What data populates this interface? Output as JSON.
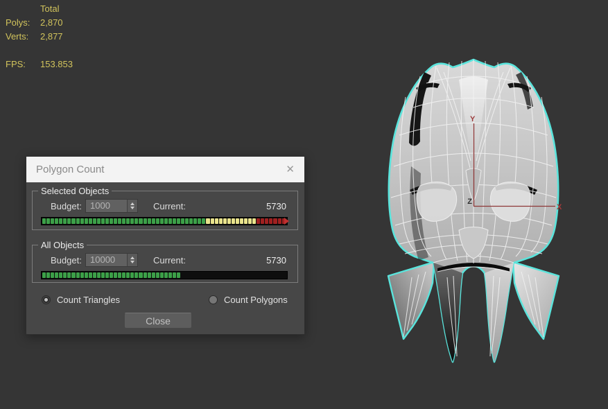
{
  "viewport": {
    "bg": "#353535"
  },
  "stats": {
    "total_header": "Total",
    "rows": [
      {
        "label": "Polys:",
        "value": "2,870"
      },
      {
        "label": "Verts:",
        "value": "2,877"
      }
    ],
    "fps": {
      "label": "FPS:",
      "value": "153.853"
    },
    "text_color": "#d2c45c"
  },
  "dialog": {
    "title": "Polygon Count",
    "close_glyph": "✕",
    "groups": [
      {
        "label": "Selected Objects",
        "budget_label": "Budget:",
        "budget_value": "1000",
        "current_label": "Current:",
        "current_value": "5730",
        "bar": {
          "total": 58,
          "green": 39,
          "yellow": 12,
          "red": 7,
          "overflow": true
        }
      },
      {
        "label": "All Objects",
        "budget_label": "Budget:",
        "budget_value": "10000",
        "current_label": "Current:",
        "current_value": "5730",
        "bar": {
          "total": 58,
          "green": 33,
          "yellow": 0,
          "red": 0,
          "overflow": false
        }
      }
    ],
    "radios": [
      {
        "label": "Count Triangles",
        "selected": true
      },
      {
        "label": "Count Polygons",
        "selected": false
      }
    ],
    "close_button": "Close"
  },
  "axes": {
    "x": "X",
    "y": "Y",
    "z": "Z"
  },
  "colors": {
    "selection_cyan": "#5ae4dc",
    "bar_green": "#3ca048",
    "bar_yellow": "#e9e38c",
    "bar_red": "#a02020",
    "axis_red": "#8e3838",
    "stats_yellow": "#d2c45c"
  }
}
